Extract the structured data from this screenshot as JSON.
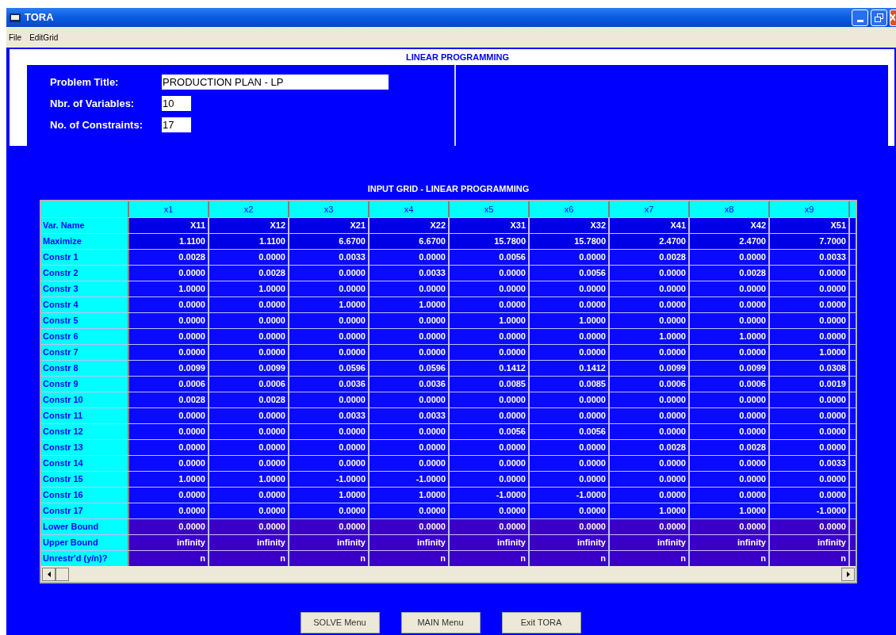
{
  "window": {
    "title": "TORA"
  },
  "menu": [
    "File",
    "EditGrid"
  ],
  "heading": "LINEAR PROGRAMMING",
  "fields": [
    {
      "label": "Problem Title:",
      "value": "PRODUCTION PLAN - LP",
      "kind": "wide"
    },
    {
      "label": "Nbr. of Variables:",
      "value": "10",
      "kind": "short"
    },
    {
      "label": "No. of Constraints:",
      "value": "17",
      "kind": "short"
    }
  ],
  "grid": {
    "title": "INPUT GRID - LINEAR PROGRAMMING",
    "columns": [
      "x1",
      "x2",
      "x3",
      "x4",
      "x5",
      "x6",
      "x7",
      "x8",
      "x9"
    ],
    "rows": [
      {
        "kind": "name",
        "label": "Var. Name",
        "cells": [
          "X11",
          "X12",
          "X21",
          "X22",
          "X31",
          "X32",
          "X41",
          "X42",
          "X51"
        ]
      },
      {
        "kind": "objective",
        "label": "Maximize",
        "cells": [
          "1.1100",
          "1.1100",
          "6.6700",
          "6.6700",
          "15.7800",
          "15.7800",
          "2.4700",
          "2.4700",
          "7.7000"
        ]
      },
      {
        "kind": "constraint",
        "label": "Constr 1",
        "cells": [
          "0.0028",
          "0.0000",
          "0.0033",
          "0.0000",
          "0.0056",
          "0.0000",
          "0.0028",
          "0.0000",
          "0.0033"
        ]
      },
      {
        "kind": "constraint",
        "label": "Constr 2",
        "cells": [
          "0.0000",
          "0.0028",
          "0.0000",
          "0.0033",
          "0.0000",
          "0.0056",
          "0.0000",
          "0.0028",
          "0.0000"
        ]
      },
      {
        "kind": "constraint",
        "label": "Constr 3",
        "cells": [
          "1.0000",
          "1.0000",
          "0.0000",
          "0.0000",
          "0.0000",
          "0.0000",
          "0.0000",
          "0.0000",
          "0.0000"
        ]
      },
      {
        "kind": "constraint",
        "label": "Constr 4",
        "cells": [
          "0.0000",
          "0.0000",
          "1.0000",
          "1.0000",
          "0.0000",
          "0.0000",
          "0.0000",
          "0.0000",
          "0.0000"
        ]
      },
      {
        "kind": "constraint",
        "label": "Constr 5",
        "cells": [
          "0.0000",
          "0.0000",
          "0.0000",
          "0.0000",
          "1.0000",
          "1.0000",
          "0.0000",
          "0.0000",
          "0.0000"
        ]
      },
      {
        "kind": "constraint",
        "label": "Constr 6",
        "cells": [
          "0.0000",
          "0.0000",
          "0.0000",
          "0.0000",
          "0.0000",
          "0.0000",
          "1.0000",
          "1.0000",
          "0.0000"
        ]
      },
      {
        "kind": "constraint",
        "label": "Constr 7",
        "cells": [
          "0.0000",
          "0.0000",
          "0.0000",
          "0.0000",
          "0.0000",
          "0.0000",
          "0.0000",
          "0.0000",
          "1.0000"
        ]
      },
      {
        "kind": "constraint",
        "label": "Constr 8",
        "cells": [
          "0.0099",
          "0.0099",
          "0.0596",
          "0.0596",
          "0.1412",
          "0.1412",
          "0.0099",
          "0.0099",
          "0.0308"
        ]
      },
      {
        "kind": "constraint",
        "label": "Constr 9",
        "cells": [
          "0.0006",
          "0.0006",
          "0.0036",
          "0.0036",
          "0.0085",
          "0.0085",
          "0.0006",
          "0.0006",
          "0.0019"
        ]
      },
      {
        "kind": "constraint",
        "label": "Constr 10",
        "cells": [
          "0.0028",
          "0.0028",
          "0.0000",
          "0.0000",
          "0.0000",
          "0.0000",
          "0.0000",
          "0.0000",
          "0.0000"
        ]
      },
      {
        "kind": "constraint",
        "label": "Constr 11",
        "cells": [
          "0.0000",
          "0.0000",
          "0.0033",
          "0.0033",
          "0.0000",
          "0.0000",
          "0.0000",
          "0.0000",
          "0.0000"
        ]
      },
      {
        "kind": "constraint",
        "label": "Constr 12",
        "cells": [
          "0.0000",
          "0.0000",
          "0.0000",
          "0.0000",
          "0.0056",
          "0.0056",
          "0.0000",
          "0.0000",
          "0.0000"
        ]
      },
      {
        "kind": "constraint",
        "label": "Constr 13",
        "cells": [
          "0.0000",
          "0.0000",
          "0.0000",
          "0.0000",
          "0.0000",
          "0.0000",
          "0.0028",
          "0.0028",
          "0.0000"
        ]
      },
      {
        "kind": "constraint",
        "label": "Constr 14",
        "cells": [
          "0.0000",
          "0.0000",
          "0.0000",
          "0.0000",
          "0.0000",
          "0.0000",
          "0.0000",
          "0.0000",
          "0.0033"
        ]
      },
      {
        "kind": "constraint",
        "label": "Constr 15",
        "cells": [
          "1.0000",
          "1.0000",
          "-1.0000",
          "-1.0000",
          "0.0000",
          "0.0000",
          "0.0000",
          "0.0000",
          "0.0000"
        ]
      },
      {
        "kind": "constraint",
        "label": "Constr 16",
        "cells": [
          "0.0000",
          "0.0000",
          "1.0000",
          "1.0000",
          "-1.0000",
          "-1.0000",
          "0.0000",
          "0.0000",
          "0.0000"
        ]
      },
      {
        "kind": "constraint",
        "label": "Constr 17",
        "cells": [
          "0.0000",
          "0.0000",
          "0.0000",
          "0.0000",
          "0.0000",
          "0.0000",
          "1.0000",
          "1.0000",
          "-1.0000"
        ]
      },
      {
        "kind": "bound",
        "label": "Lower Bound",
        "cells": [
          "0.0000",
          "0.0000",
          "0.0000",
          "0.0000",
          "0.0000",
          "0.0000",
          "0.0000",
          "0.0000",
          "0.0000"
        ]
      },
      {
        "kind": "bound",
        "label": "Upper Bound",
        "cells": [
          "infinity",
          "infinity",
          "infinity",
          "infinity",
          "infinity",
          "infinity",
          "infinity",
          "infinity",
          "infinity"
        ]
      },
      {
        "kind": "bound",
        "label": "Unrestr'd (y/n)?",
        "cells": [
          "n",
          "n",
          "n",
          "n",
          "n",
          "n",
          "n",
          "n",
          "n"
        ]
      }
    ]
  },
  "buttons": [
    "SOLVE Menu",
    "MAIN Menu",
    "Exit TORA"
  ]
}
